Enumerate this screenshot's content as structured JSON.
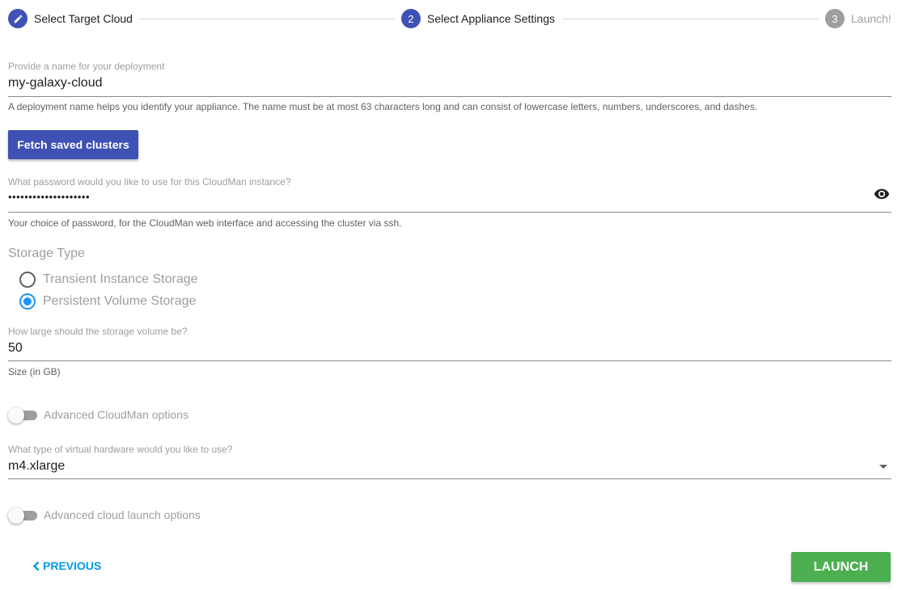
{
  "stepper": {
    "steps": [
      {
        "number": "",
        "icon": "pencil-icon",
        "label": "Select Target Cloud",
        "state": "done"
      },
      {
        "number": "2",
        "label": "Select Appliance Settings",
        "state": "active"
      },
      {
        "number": "3",
        "label": "Launch!",
        "state": "inactive"
      }
    ]
  },
  "deployment": {
    "label": "Provide a name for your deployment",
    "value": "my-galaxy-cloud",
    "hint": "A deployment name helps you identify your appliance. The name must be at most 63 characters long and can consist of lowercase letters, numbers, underscores, and dashes."
  },
  "fetch_button": {
    "label": "Fetch saved clusters"
  },
  "password": {
    "label": "What password would you like to use for this CloudMan instance?",
    "value": "••••••••••••••••••••",
    "hint": "Your choice of password, for the CloudMan web interface and accessing the cluster via ssh.",
    "toggle_icon": "eye-icon"
  },
  "storage": {
    "title": "Storage Type",
    "options": [
      {
        "label": "Transient Instance Storage",
        "checked": false
      },
      {
        "label": "Persistent Volume Storage",
        "checked": true
      }
    ]
  },
  "volume": {
    "label": "How large should the storage volume be?",
    "value": "50",
    "hint": "Size (in GB)"
  },
  "advanced_cloudman": {
    "label": "Advanced CloudMan options",
    "on": false
  },
  "hardware": {
    "label": "What type of virtual hardware would you like to use?",
    "value": "m4.xlarge"
  },
  "advanced_launch": {
    "label": "Advanced cloud launch options",
    "on": false
  },
  "footer": {
    "previous_label": "PREVIOUS",
    "launch_label": "LAUNCH"
  },
  "colors": {
    "primary": "#3f51b5",
    "radio_accent": "#2196f3",
    "link": "#039be5",
    "launch": "#4caf50"
  }
}
